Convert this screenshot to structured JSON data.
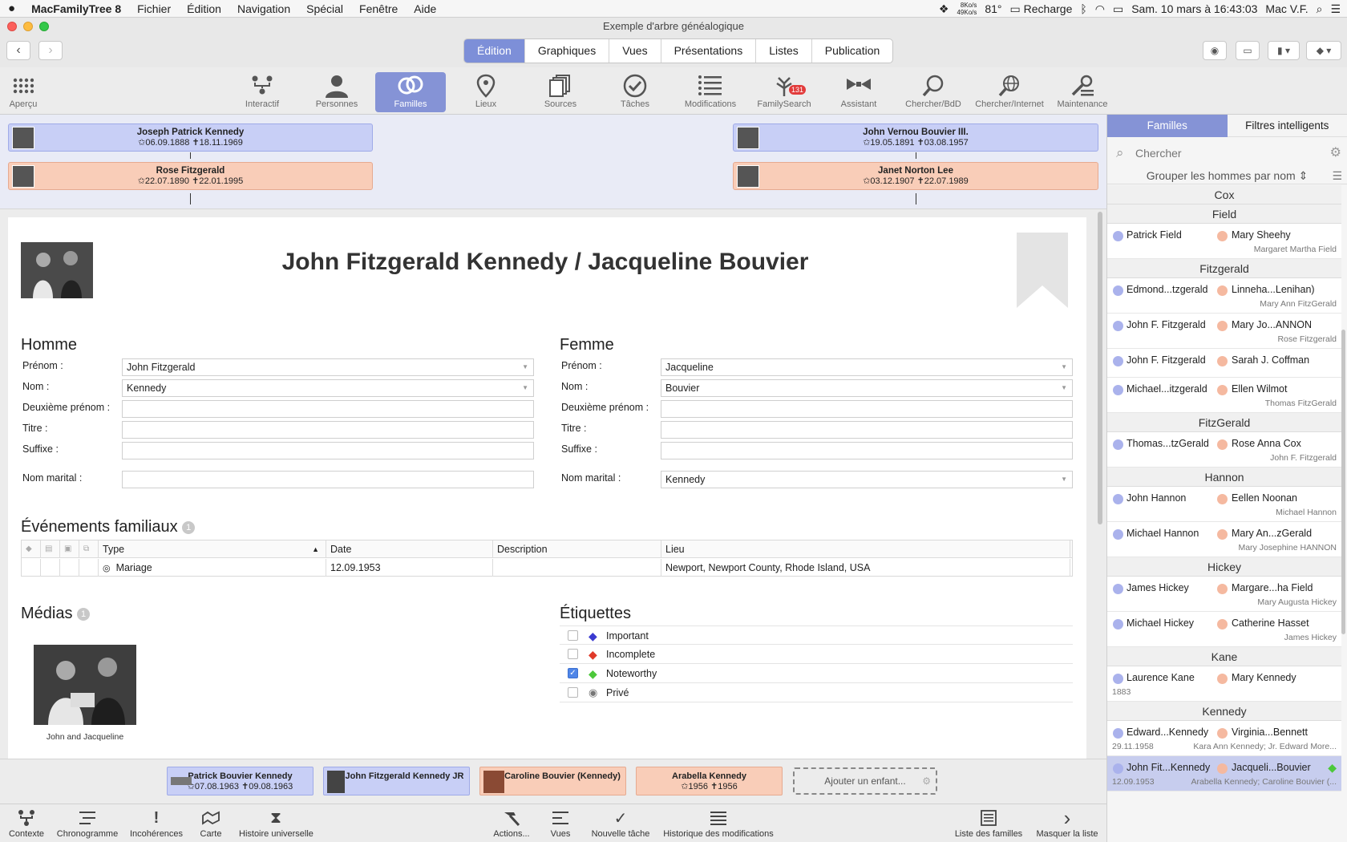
{
  "menubar": {
    "app": "MacFamilyTree 8",
    "items": [
      "Fichier",
      "Édition",
      "Navigation",
      "Spécial",
      "Fenêtre",
      "Aide"
    ],
    "net_up": "8Ko/s",
    "net_down": "49Ko/s",
    "temp": "81°",
    "battery": "Recharge",
    "datetime": "Sam. 10 mars à 16:43:03",
    "user": "Mac V.F."
  },
  "window": {
    "title": "Exemple d'arbre généalogique"
  },
  "tabs": [
    "Édition",
    "Graphiques",
    "Vues",
    "Présentations",
    "Listes",
    "Publication"
  ],
  "toolbar": [
    {
      "label": "Aperçu",
      "icon": "grid-icon"
    },
    {
      "label": "Interactif",
      "icon": "interactive-tree-icon"
    },
    {
      "label": "Personnes",
      "icon": "person-icon"
    },
    {
      "label": "Familles",
      "icon": "rings-icon"
    },
    {
      "label": "Lieux",
      "icon": "map-pin-icon"
    },
    {
      "label": "Sources",
      "icon": "sources-icon"
    },
    {
      "label": "Tâches",
      "icon": "checkmark-icon"
    },
    {
      "label": "Modifications",
      "icon": "list-icon"
    },
    {
      "label": "FamilySearch",
      "icon": "familysearch-icon",
      "badge": "131"
    },
    {
      "label": "Assistant",
      "icon": "bowtie-icon"
    },
    {
      "label": "Chercher/BdD",
      "icon": "magnifier-icon"
    },
    {
      "label": "Chercher/Internet",
      "icon": "globe-search-icon"
    },
    {
      "label": "Maintenance",
      "icon": "maintenance-icon"
    }
  ],
  "parents": {
    "husband_father": {
      "name": "Joseph Patrick Kennedy",
      "dates": "✩06.09.1888  ✝18.11.1969"
    },
    "husband_mother": {
      "name": "Rose Fitzgerald",
      "dates": "✩22.07.1890  ✝22.01.1995"
    },
    "wife_father": {
      "name": "John Vernou Bouvier III.",
      "dates": "✩19.05.1891  ✝03.08.1957"
    },
    "wife_mother": {
      "name": "Janet Norton Lee",
      "dates": "✩03.12.1907  ✝22.07.1989"
    }
  },
  "family_title": "John Fitzgerald Kennedy / Jacqueline Bouvier",
  "man": {
    "heading": "Homme",
    "labels": {
      "first": "Prénom :",
      "last": "Nom :",
      "middle": "Deuxième prénom :",
      "title": "Titre :",
      "suffix": "Suffixe :",
      "married": "Nom marital :"
    },
    "values": {
      "first": "John Fitzgerald",
      "last": "Kennedy",
      "middle": "",
      "title": "",
      "suffix": "",
      "married": ""
    }
  },
  "woman": {
    "heading": "Femme",
    "labels": {
      "first": "Prénom :",
      "last": "Nom :",
      "middle": "Deuxième prénom :",
      "title": "Titre :",
      "suffix": "Suffixe :",
      "married": "Nom marital :"
    },
    "values": {
      "first": "Jacqueline",
      "last": "Bouvier",
      "middle": "",
      "title": "",
      "suffix": "",
      "married": "Kennedy"
    }
  },
  "events": {
    "heading": "Événements familiaux",
    "count": "1",
    "columns": {
      "type": "Type",
      "date": "Date",
      "description": "Description",
      "place": "Lieu"
    },
    "rows": [
      {
        "type": "Mariage",
        "date": "12.09.1953",
        "description": "",
        "place": "Newport, Newport County, Rhode Island, USA"
      }
    ]
  },
  "media": {
    "heading": "Médias",
    "count": "1",
    "caption": "John and Jacqueline"
  },
  "tags": {
    "heading": "Étiquettes",
    "items": [
      {
        "label": "Important",
        "checked": false,
        "color": "#3a3ad0"
      },
      {
        "label": "Incomplete",
        "checked": false,
        "color": "#e03a2a"
      },
      {
        "label": "Noteworthy",
        "checked": true,
        "color": "#4cc83a"
      },
      {
        "label": "Privé",
        "checked": false,
        "color": "#888888"
      }
    ]
  },
  "children": [
    {
      "name": "Patrick Bouvier Kennedy",
      "dates": "✩07.08.1963  ✝09.08.1963",
      "sex": "m"
    },
    {
      "name": "John Fitzgerald Kennedy JR",
      "dates": "",
      "sex": "m"
    },
    {
      "name": "Caroline Bouvier (Kennedy)",
      "dates": "",
      "sex": "f"
    },
    {
      "name": "Arabella Kennedy",
      "dates": "✩1956  ✝1956",
      "sex": "f"
    }
  ],
  "add_child": "Ajouter un enfant...",
  "bottombar": {
    "left": [
      {
        "label": "Contexte",
        "icon": "context-icon"
      },
      {
        "label": "Chronogramme",
        "icon": "timeline-icon"
      },
      {
        "label": "Incohérences",
        "icon": "exclamation-icon"
      },
      {
        "label": "Carte",
        "icon": "map-icon"
      },
      {
        "label": "Histoire universelle",
        "icon": "hourglass-icon"
      }
    ],
    "center": [
      {
        "label": "Actions...",
        "icon": "hammer-icon"
      },
      {
        "label": "Vues",
        "icon": "views-icon"
      },
      {
        "label": "Nouvelle tâche",
        "icon": "new-task-icon"
      },
      {
        "label": "Historique des modifications",
        "icon": "history-list-icon"
      }
    ],
    "right": [
      {
        "label": "Liste des familles",
        "icon": "family-list-icon"
      },
      {
        "label": "Masquer la liste",
        "icon": "chevron-right-icon"
      }
    ]
  },
  "sidebar": {
    "tabs": [
      "Familles",
      "Filtres intelligents"
    ],
    "search_placeholder": "Chercher",
    "group_by": "Grouper les hommes par nom",
    "groups": [
      {
        "name": "Cox",
        "rows": []
      },
      {
        "name": "Field",
        "rows": [
          {
            "husband": "Patrick Field",
            "wife": "Mary Sheehy",
            "sub": "Margaret Martha Field"
          }
        ]
      },
      {
        "name": "Fitzgerald",
        "rows": [
          {
            "husband": "Edmond...tzgerald",
            "wife": "Linneha...Lenihan)",
            "sub": "Mary Ann FitzGerald"
          },
          {
            "husband": "John F. Fitzgerald",
            "wife": "Mary Jo...ANNON",
            "sub": "Rose Fitzgerald"
          },
          {
            "husband": "John F. Fitzgerald",
            "wife": "Sarah J. Coffman",
            "sub": ""
          },
          {
            "husband": "Michael...itzgerald",
            "wife": "Ellen Wilmot",
            "sub": "Thomas FitzGerald"
          }
        ]
      },
      {
        "name": "FitzGerald",
        "rows": [
          {
            "husband": "Thomas...tzGerald",
            "wife": "Rose Anna Cox",
            "sub": "John F. Fitzgerald"
          }
        ]
      },
      {
        "name": "Hannon",
        "rows": [
          {
            "husband": "John Hannon",
            "wife": "Eellen Noonan",
            "sub": "Michael Hannon"
          },
          {
            "husband": "Michael Hannon",
            "wife": "Mary An...zGerald",
            "sub": "Mary Josephine HANNON"
          }
        ]
      },
      {
        "name": "Hickey",
        "rows": [
          {
            "husband": "James Hickey",
            "wife": "Margare...ha Field",
            "sub": "Mary Augusta Hickey"
          },
          {
            "husband": "Michael Hickey",
            "wife": "Catherine Hasset",
            "sub": "James Hickey"
          }
        ]
      },
      {
        "name": "Kane",
        "rows": [
          {
            "husband": "Laurence Kane",
            "wife": "Mary Kennedy",
            "sub": "",
            "date": "1883"
          }
        ]
      },
      {
        "name": "Kennedy",
        "rows": [
          {
            "husband": "Edward...Kennedy",
            "wife": "Virginia...Bennett",
            "sub": "Kara Ann Kennedy; Jr. Edward More...",
            "date": "29.11.1958"
          },
          {
            "husband": "John Fit...Kennedy",
            "wife": "Jacqueli...Bouvier",
            "sub": "Arabella Kennedy; Caroline Bouvier (...",
            "date": "12.09.1953",
            "selected": true
          }
        ]
      }
    ]
  }
}
